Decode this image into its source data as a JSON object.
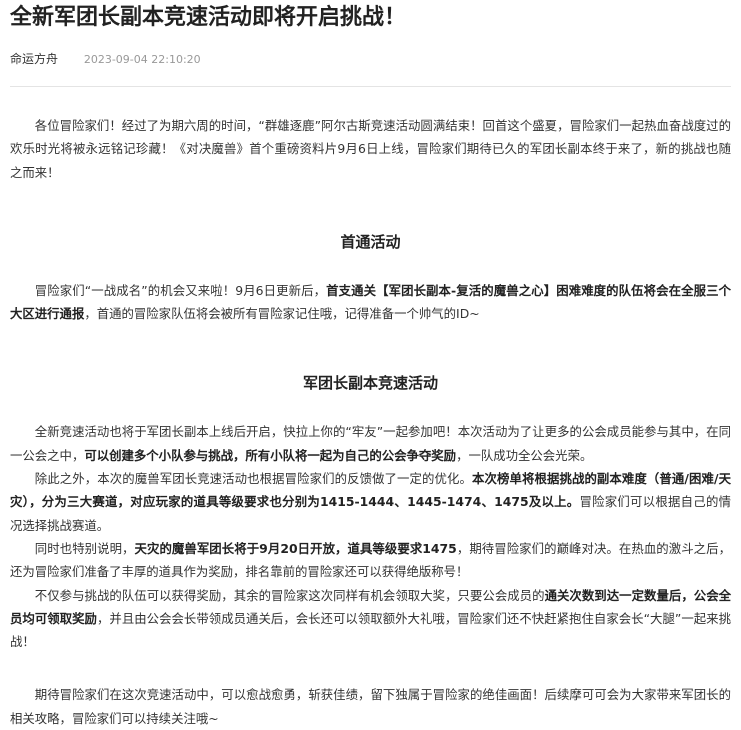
{
  "article": {
    "title": "全新军团长副本竞速活动即将开启挑战！",
    "author": "命运方舟",
    "date": "2023-09-04 22:10:20",
    "intro": [
      {
        "t": "各位冒险家们！经过了为期六周的时间，“群雄逐鹿”阿尔古斯竞速活动圆满结束！回首这个盛夏，冒险家们一起热血奋战度过的欢乐时光将被永远铭记珍藏！《对决魔兽》首个重磅资料片9月6日上线，冒险家们期待已久的军团长副本终于来了，新的挑战也随之而来！",
        "b": false
      }
    ],
    "section1_heading": "首通活动",
    "section1": [
      {
        "t": "冒险家们“一战成名”的机会又来啦！9月6日更新后，",
        "b": false
      },
      {
        "t": "首支通关【军团长副本-复活的魔兽之心】困难难度的队伍将会在全服三个大区进行通报",
        "b": true
      },
      {
        "t": "，首通的冒险家队伍将会被所有冒险家记住哦，记得准备一个帅气的ID~",
        "b": false
      }
    ],
    "section2_heading": "军团长副本竞速活动",
    "section2_p1": [
      {
        "t": "全新竞速活动也将于军团长副本上线后开启，快拉上你的“牢友”一起参加吧！本次活动为了让更多的公会成员能参与其中，在同一公会之中，",
        "b": false
      },
      {
        "t": "可以创建多个小队参与挑战，所有小队将一起为自己的公会争夺奖励",
        "b": true
      },
      {
        "t": "，一队成功全公会光荣。",
        "b": false
      }
    ],
    "section2_p2": [
      {
        "t": "除此之外，本次的魔兽军团长竞速活动也根据冒险家们的反馈做了一定的优化。",
        "b": false
      },
      {
        "t": "本次榜单将根据挑战的副本难度（普通/困难/天灾），分为三大赛道，对应玩家的道具等级要求也分别为1415-1444、1445-1474、1475及以上。",
        "b": true
      },
      {
        "t": "冒险家们可以根据自己的情况选择挑战赛道。",
        "b": false
      }
    ],
    "section2_p3": [
      {
        "t": "同时也特别说明，",
        "b": false
      },
      {
        "t": "天灾的魔兽军团长将于9月20日开放，道具等级要求1475",
        "b": true
      },
      {
        "t": "，期待冒险家们的巅峰对决。在热血的激斗之后，还为冒险家们准备了丰厚的道具作为奖励，排名靠前的冒险家还可以获得绝版称号！",
        "b": false
      }
    ],
    "section2_p4": [
      {
        "t": "不仅参与挑战的队伍可以获得奖励，其余的冒险家这次同样有机会领取大奖，只要公会成员的",
        "b": false
      },
      {
        "t": "通关次数到达一定数量后，公会全员均可领取奖励",
        "b": true
      },
      {
        "t": "，并且由公会会长带领成员通关后，会长还可以领取额外大礼哦，冒险家们还不快赶紧抱住自家会长“大腿”一起来挑战！",
        "b": false
      }
    ],
    "outro": [
      {
        "t": "期待冒险家们在这次竞速活动中，可以愈战愈勇，斩获佳绩，留下独属于冒险家的绝佳画面！后续摩可可会为大家带来军团长的相关攻略，冒险家们可以持续关注哦~",
        "b": false
      }
    ]
  }
}
